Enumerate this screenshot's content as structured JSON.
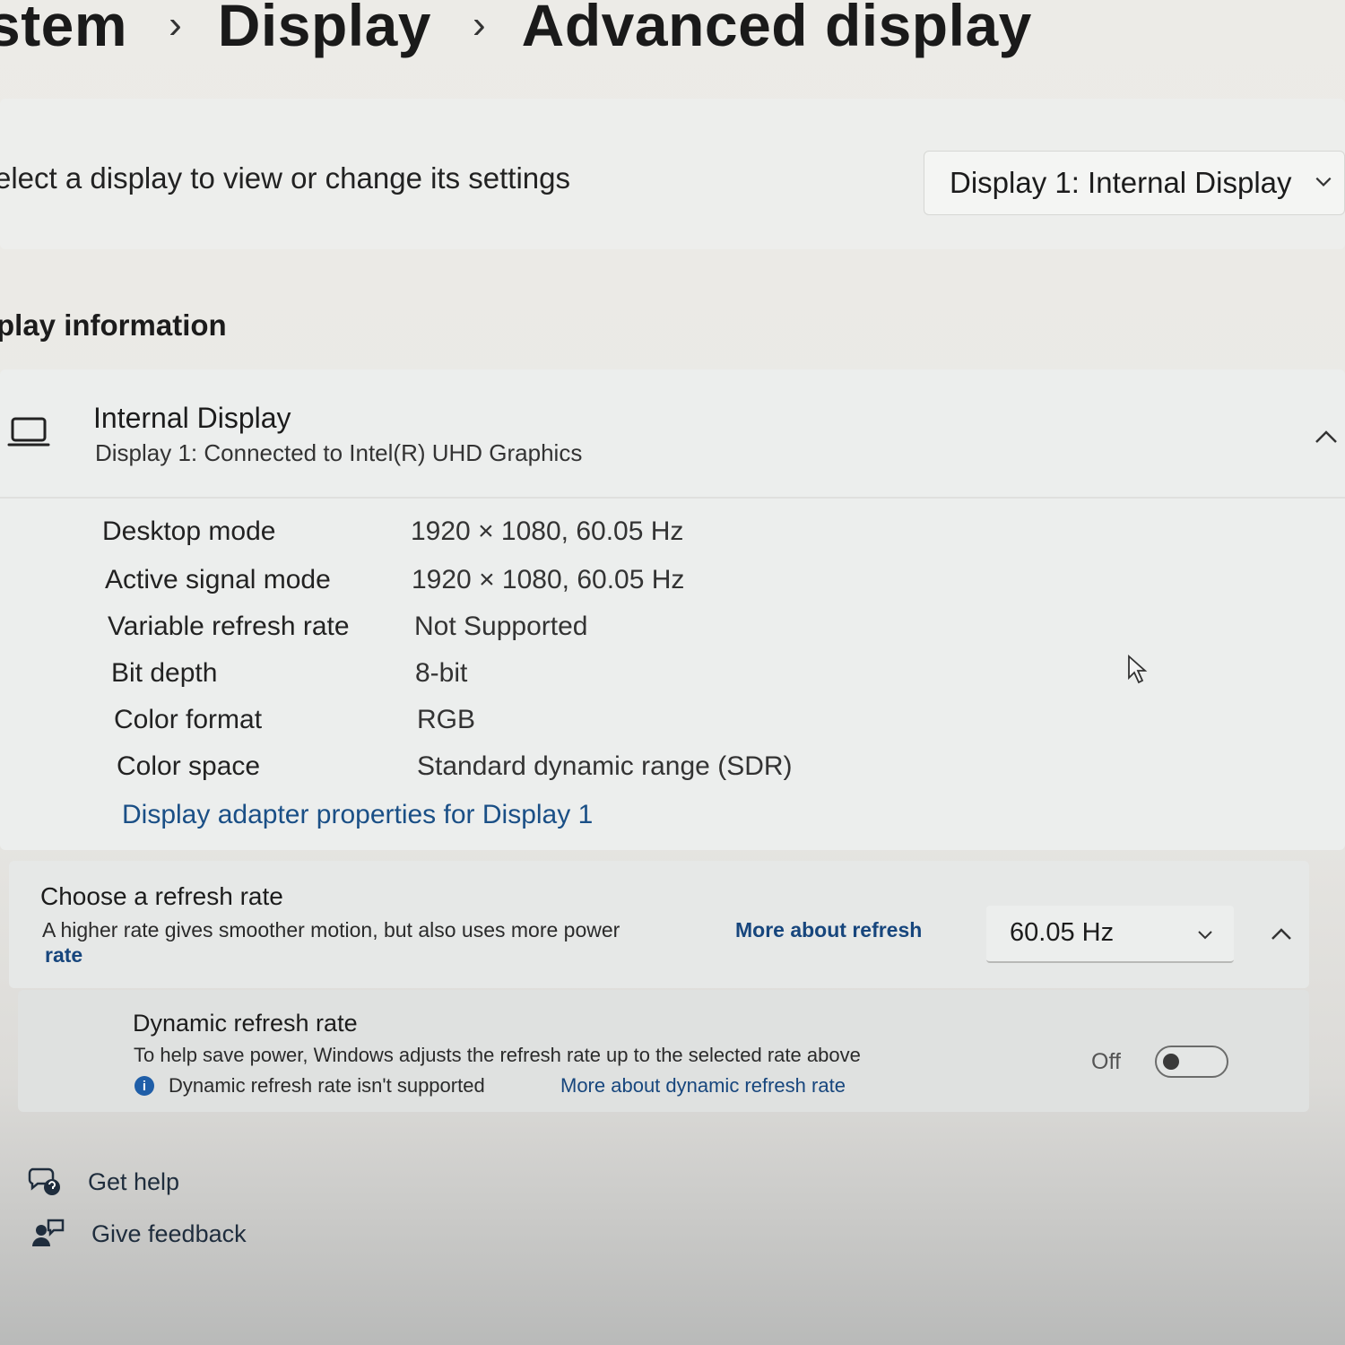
{
  "breadcrumb": {
    "items": [
      "stem",
      "Display",
      "Advanced display"
    ],
    "separator": "›"
  },
  "select_display": {
    "label": "elect a display to view or change its settings",
    "selected": "Display 1: Internal Display"
  },
  "display_information": {
    "section_title": "play information",
    "name": "Internal Display",
    "connection": "Display 1: Connected to Intel(R) UHD Graphics",
    "properties": [
      {
        "label": "Desktop mode",
        "value": "1920 × 1080, 60.05 Hz"
      },
      {
        "label": "Active signal mode",
        "value": "1920 × 1080, 60.05 Hz"
      },
      {
        "label": "Variable refresh rate",
        "value": "Not Supported"
      },
      {
        "label": "Bit depth",
        "value": "8-bit"
      },
      {
        "label": "Color format",
        "value": "RGB"
      },
      {
        "label": "Color space",
        "value": "Standard dynamic range (SDR)"
      }
    ],
    "adapter_link": "Display adapter properties for Display 1"
  },
  "refresh_rate": {
    "title": "Choose a refresh rate",
    "description": "A higher rate gives smoother motion, but also uses more power",
    "link_part1": "More about refresh",
    "link_part2": "rate",
    "selected": "60.05 Hz"
  },
  "dynamic_refresh": {
    "title": "Dynamic refresh rate",
    "description": "To help save power, Windows adjusts the refresh rate up to the selected rate above",
    "info_icon_glyph": "i",
    "info": "Dynamic refresh rate isn't supported",
    "link": "More about dynamic refresh rate",
    "toggle_label": "Off",
    "toggle_on": false
  },
  "footer": {
    "get_help": "Get help",
    "give_feedback": "Give feedback"
  },
  "colors": {
    "link": "#1a4f86",
    "info_badge": "#1f5ea8"
  }
}
